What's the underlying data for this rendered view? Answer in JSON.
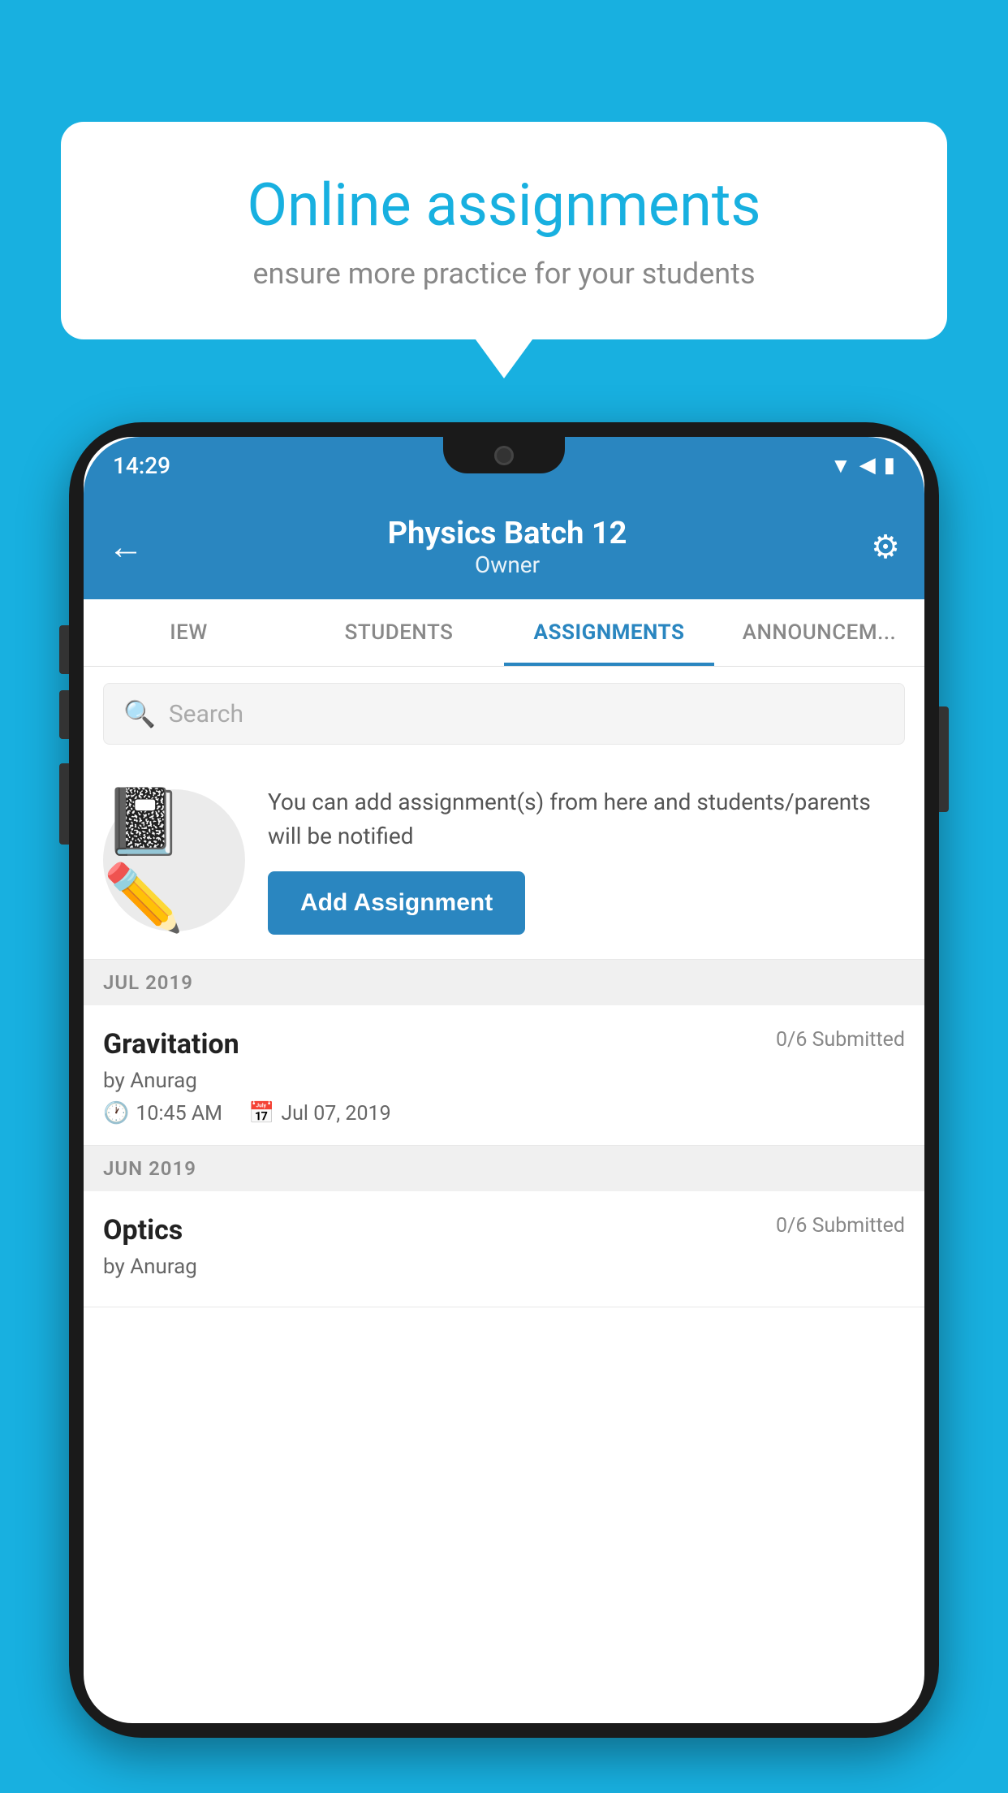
{
  "background_color": "#18b0e0",
  "speech_bubble": {
    "title": "Online assignments",
    "subtitle": "ensure more practice for your students"
  },
  "phone": {
    "status_bar": {
      "time": "14:29"
    },
    "app_bar": {
      "title": "Physics Batch 12",
      "subtitle": "Owner",
      "back_label": "←",
      "settings_label": "⚙"
    },
    "tabs": [
      {
        "label": "IEW",
        "active": false
      },
      {
        "label": "STUDENTS",
        "active": false
      },
      {
        "label": "ASSIGNMENTS",
        "active": true
      },
      {
        "label": "ANNOUNCEM...",
        "active": false
      }
    ],
    "search": {
      "placeholder": "Search"
    },
    "promo": {
      "description": "You can add assignment(s) from here and students/parents will be notified",
      "button_label": "Add Assignment"
    },
    "sections": [
      {
        "label": "JUL 2019",
        "assignments": [
          {
            "title": "Gravitation",
            "submitted": "0/6 Submitted",
            "author": "by Anurag",
            "time": "10:45 AM",
            "date": "Jul 07, 2019"
          }
        ]
      },
      {
        "label": "JUN 2019",
        "assignments": [
          {
            "title": "Optics",
            "submitted": "0/6 Submitted",
            "author": "by Anurag",
            "time": "",
            "date": ""
          }
        ]
      }
    ]
  }
}
